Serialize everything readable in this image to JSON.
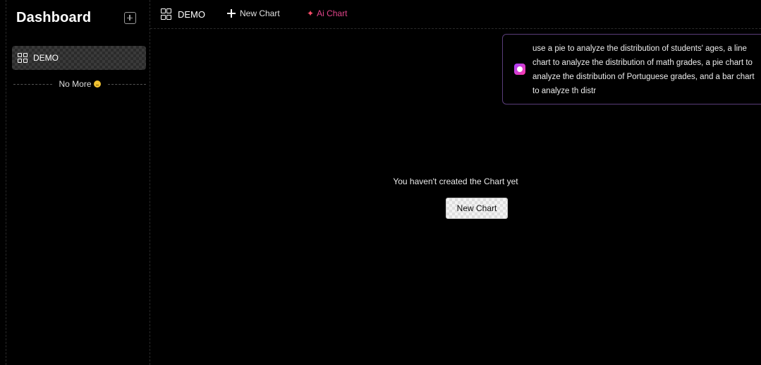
{
  "sidebar": {
    "title": "Dashboard",
    "items": [
      {
        "label": "DEMO"
      }
    ],
    "no_more": "No More"
  },
  "topbar": {
    "tab_label": "DEMO",
    "new_chart_label": "New Chart",
    "ai_chart_label": "Ai Chart"
  },
  "main": {
    "empty_message": "You haven't created the Chart yet",
    "new_chart_button": "New Chart"
  },
  "ai_prompt": {
    "value": "use a pie to analyze the distribution of students' ages, a line chart to analyze the distribution of math grades, a pie chart to analyze the distribution of Portuguese grades, and a bar chart to analyze th distr"
  },
  "colors": {
    "ai_accent": "#e0448a",
    "panel_border": "#5a3d7a"
  }
}
